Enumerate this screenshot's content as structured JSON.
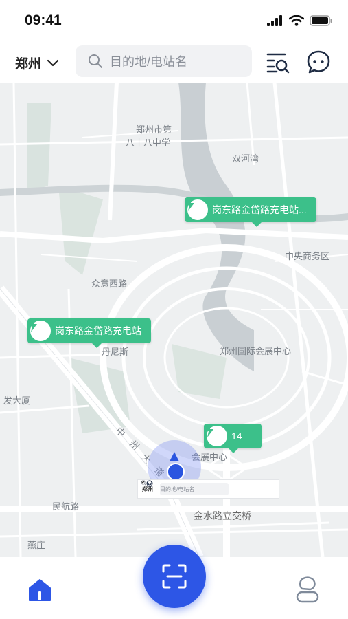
{
  "status": {
    "time": "09:41"
  },
  "header": {
    "city": "郑州",
    "search_placeholder": "目的地/电站名"
  },
  "map": {
    "labels": [
      {
        "text": "郑州市第"
      },
      {
        "text": "八十八中学"
      },
      {
        "text": "双河湾"
      },
      {
        "text": "中央商务区"
      },
      {
        "text": "众意西路"
      },
      {
        "text": "丹尼斯"
      },
      {
        "text": "郑州国际会展中心"
      },
      {
        "text": "发大厦"
      },
      {
        "text": "中"
      },
      {
        "text": "州"
      },
      {
        "text": "大"
      },
      {
        "text": "道"
      },
      {
        "text": "会展中心"
      },
      {
        "text": "民航路"
      },
      {
        "text": "金水路立交桥"
      },
      {
        "text": "燕庄"
      }
    ],
    "pins": [
      {
        "label": "岗东路金岱路充电站..."
      },
      {
        "label": "岗东路金岱路充电站"
      },
      {
        "label": "14"
      }
    ],
    "mini_header": {
      "city": "郑州",
      "search_placeholder": "目的地/电站名"
    }
  },
  "tabbar": {
    "home_icon": "home-icon",
    "scan_icon": "scan-icon",
    "profile_icon": "profile-icon"
  },
  "colors": {
    "accent": "#2d56e6",
    "station_green": "#3cc08a"
  }
}
